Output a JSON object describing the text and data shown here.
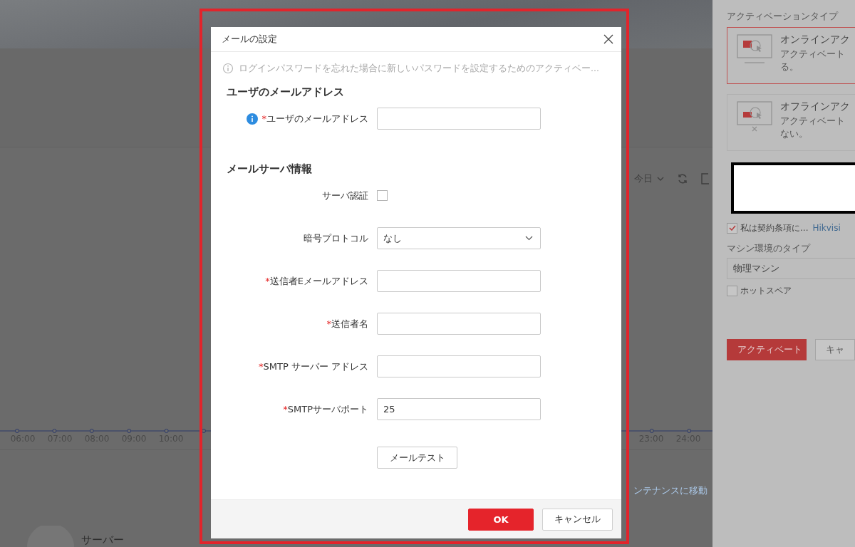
{
  "page": {
    "period": "今日",
    "ticks_left": [
      "06:00",
      "07:00",
      "08:00",
      "09:00",
      "10:00"
    ],
    "ticks_right": [
      "23:00",
      "24:00"
    ],
    "maintenance_link": "ンテナンスに移動",
    "server_label": "サーバー"
  },
  "side_panel": {
    "heading": "アクティベーションタイプ",
    "cards": [
      {
        "title": "オンラインアク",
        "desc": "アクティベート",
        "desc_end": "る。",
        "selected": true,
        "kind": "online"
      },
      {
        "title": "オフラインアク",
        "desc": "アクティベート",
        "desc_end": "ない。",
        "selected": false,
        "kind": "offline"
      }
    ],
    "agree": {
      "label": "私は契約条項に...",
      "checked": true,
      "link": "Hikvisi"
    },
    "machine_label": "マシン環境のタイプ",
    "machine_value": "物理マシン",
    "hot_spare": {
      "label": "ホットスペア",
      "checked": false
    },
    "buttons": [
      {
        "label": "アクティベート",
        "primary": true
      },
      {
        "label": "キャ",
        "primary": false
      }
    ]
  },
  "dialog": {
    "title": "メールの設定",
    "notice": "ログインパスワードを忘れた場合に新しいパスワードを設定するためのアクティベー...",
    "sections": [
      {
        "heading": "ユーザのメールアドレス",
        "fields": [
          {
            "kind": "text",
            "label": "ユーザのメールアドレス",
            "mark": "*",
            "info": true
          }
        ]
      },
      {
        "heading": "メールサーバ情報",
        "fields": [
          {
            "kind": "checkbox",
            "label": "サーバ認証",
            "checked": false
          },
          {
            "kind": "select",
            "label": "暗号プロトコル",
            "value": "なし"
          },
          {
            "kind": "text",
            "label": "送信者Eメールアドレス",
            "mark": "*"
          },
          {
            "kind": "text",
            "label": "送信者名",
            "mark": "*"
          },
          {
            "kind": "text",
            "label": "SMTP サーバー アドレス",
            "mark": "*"
          },
          {
            "kind": "text",
            "label": "SMTPサーバポート",
            "mark": "*",
            "value": "25"
          }
        ]
      }
    ],
    "test_button": "メールテスト",
    "buttons": [
      {
        "label": "OK",
        "primary": true
      },
      {
        "label": "キャンセル",
        "primary": false
      }
    ]
  }
}
